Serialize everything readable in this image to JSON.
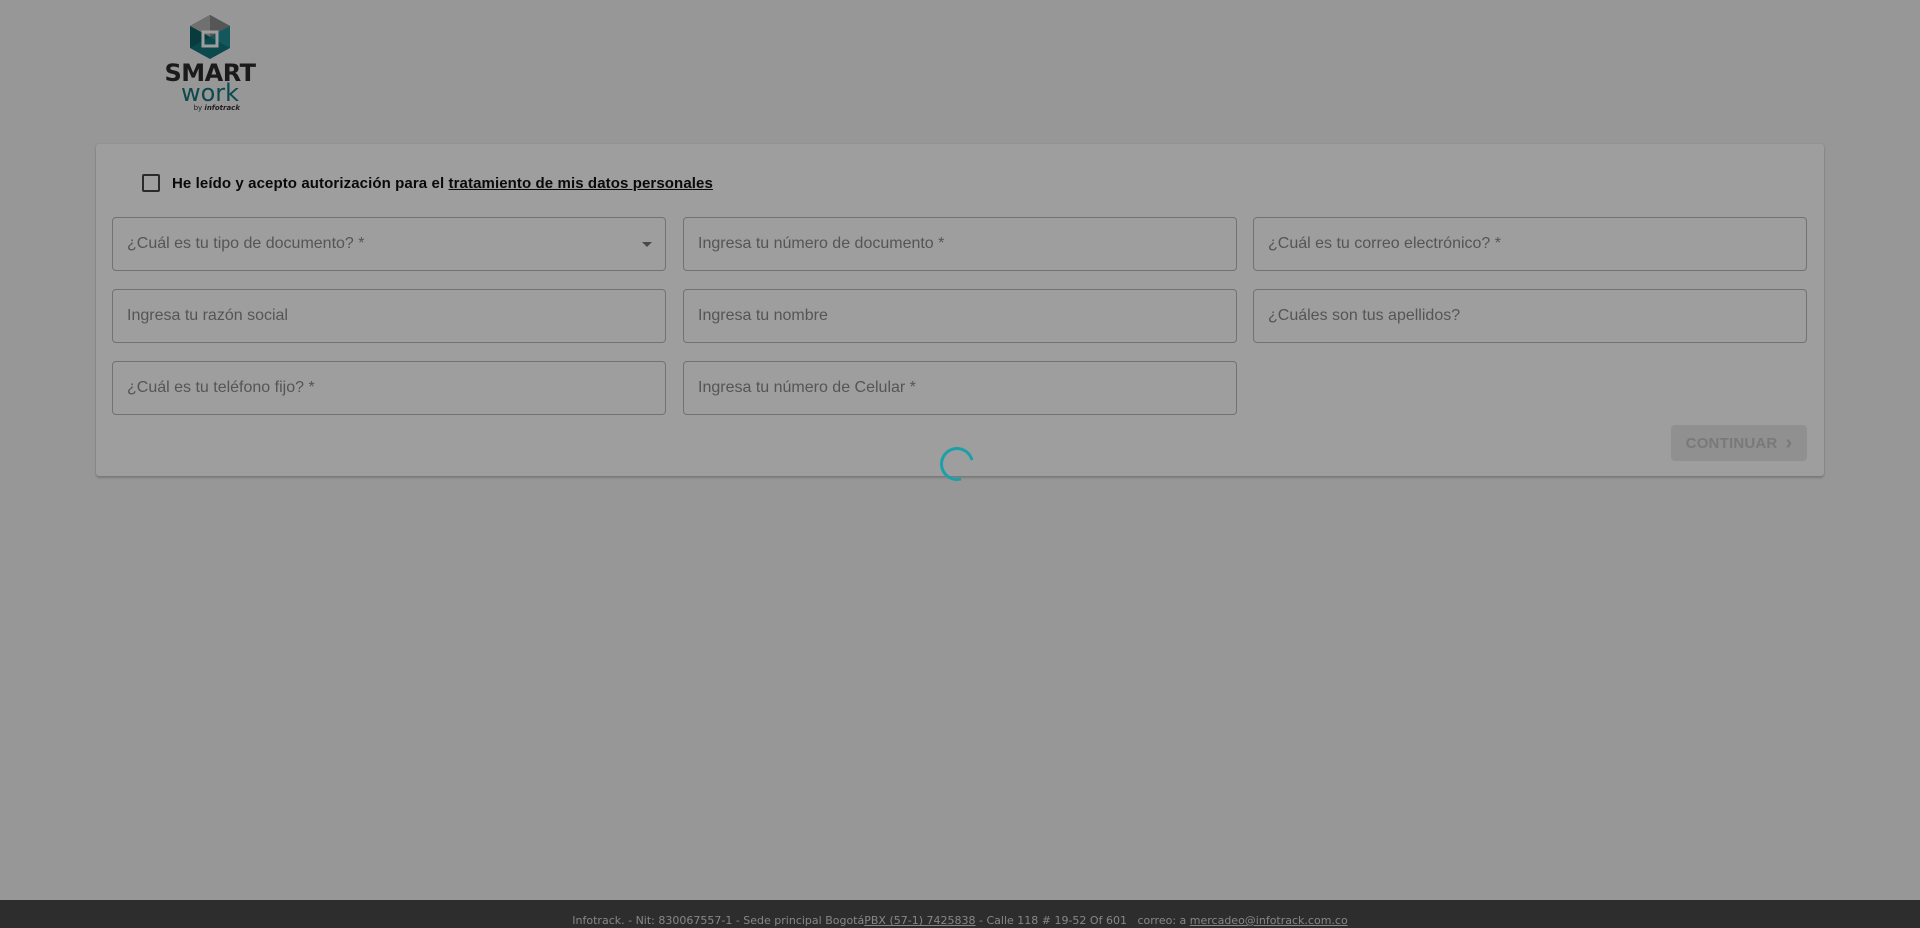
{
  "brand": {
    "name_top": "SMART",
    "name_bottom": "work",
    "byline_prefix": "by",
    "byline_company": "infotrack",
    "colors": {
      "teal": "#12777d",
      "dark": "#2b2b2b"
    }
  },
  "form": {
    "consent": {
      "checked": false,
      "text": "He leído y acepto autorización para el",
      "link": "tratamiento de mis datos personales"
    },
    "fields": {
      "document_type": {
        "placeholder": "¿Cuál es tu tipo de documento? *",
        "value": ""
      },
      "document_number": {
        "placeholder": "Ingresa tu número de documento *",
        "value": ""
      },
      "email": {
        "placeholder": "¿Cuál es tu correo electrónico? *",
        "value": ""
      },
      "business_name": {
        "placeholder": "Ingresa tu razón social",
        "value": ""
      },
      "first_name": {
        "placeholder": "Ingresa tu nombre",
        "value": ""
      },
      "last_names": {
        "placeholder": "¿Cuáles son tus apellidos?",
        "value": ""
      },
      "landline": {
        "placeholder": "¿Cuál es tu teléfono fijo? *",
        "value": ""
      },
      "mobile": {
        "placeholder": "Ingresa tu número de Celular *",
        "value": ""
      }
    },
    "continue_label": "CONTINUAR",
    "continue_icon": "chevron-right-icon",
    "continue_disabled": true
  },
  "loading": {
    "visible": true,
    "icon": "spinner-icon",
    "color": "#1aa0a6"
  },
  "footer": {
    "company": "Infotrack. - Nit: 830067557-1 - Sede principal Bogotá",
    "pbx": "PBX (57-1) 7425838",
    "address": " - Calle 118 # 19-52 Of 601   correo: a ",
    "email": "mercadeo@infotrack.com.co"
  }
}
